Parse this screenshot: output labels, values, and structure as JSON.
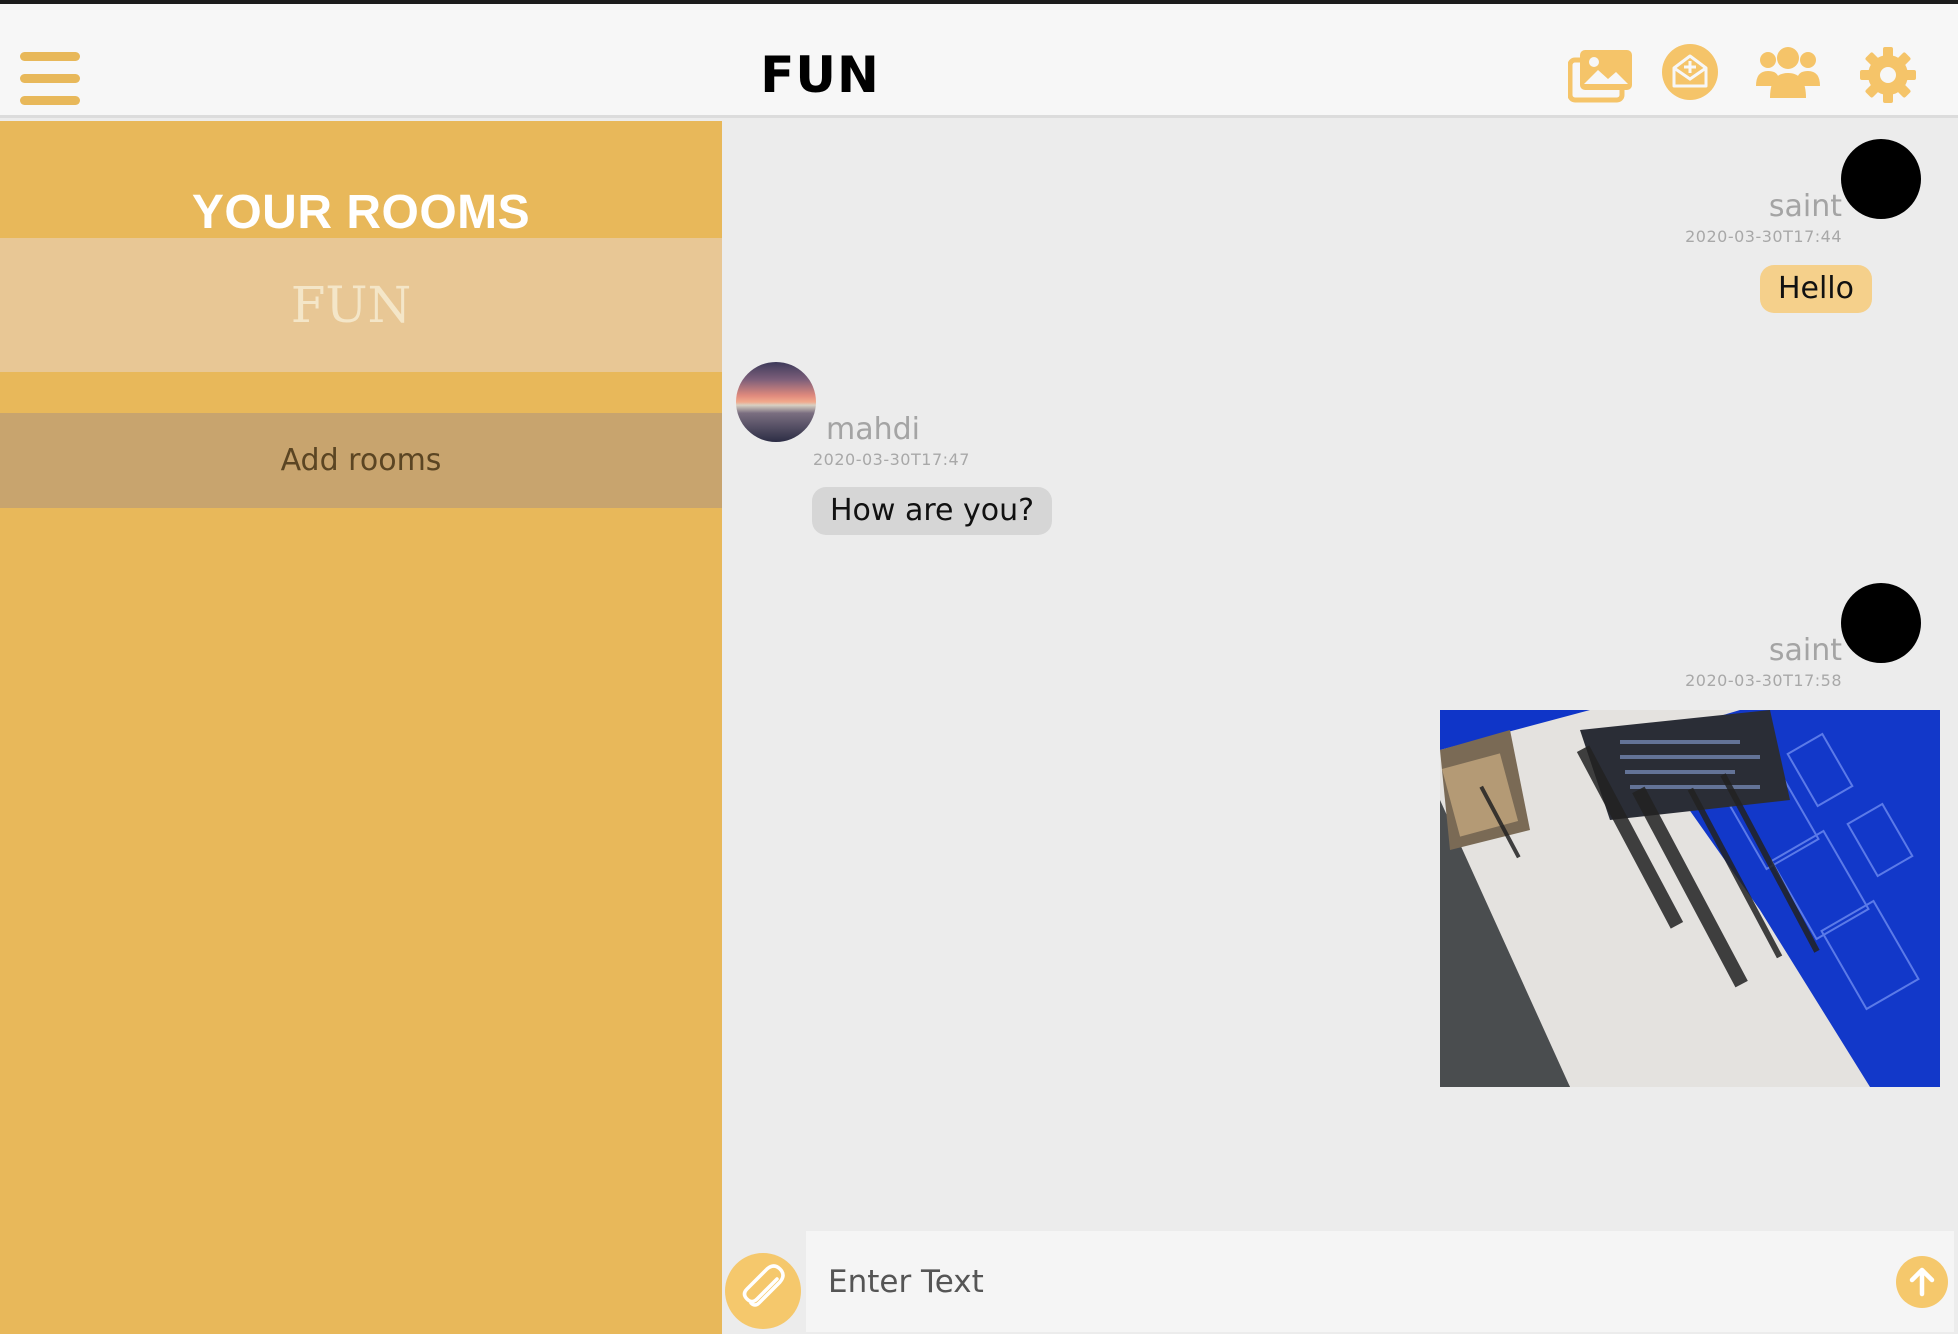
{
  "header": {
    "title": "FUN",
    "icons": [
      "menu-icon",
      "gallery-icon",
      "invite-mail-icon",
      "members-icon",
      "gear-icon"
    ]
  },
  "sidebar": {
    "title": "YOUR ROOMS",
    "rooms": [
      {
        "label": "FUN"
      }
    ],
    "add_rooms_label": "Add rooms"
  },
  "messages": [
    {
      "username": "saint",
      "timestamp": "2020-03-30T17:44",
      "text": "Hello",
      "side": "right"
    },
    {
      "username": "mahdi",
      "timestamp": "2020-03-30T17:47",
      "text": "How are you?",
      "side": "left"
    },
    {
      "username": "saint",
      "timestamp": "2020-03-30T17:58",
      "image": "photo of a laptop screen showing a slide",
      "side": "right"
    }
  ],
  "composer": {
    "placeholder": "Enter Text",
    "attach_icon": "paperclip-icon",
    "send_icon": "arrow-up-icon"
  },
  "colors": {
    "accent": "#e8b85a",
    "sidebar_active": "#e8c795",
    "add_rooms_bg": "#c8a46e",
    "own_bubble": "#f5d08b",
    "other_bubble": "#d6d6d6"
  }
}
